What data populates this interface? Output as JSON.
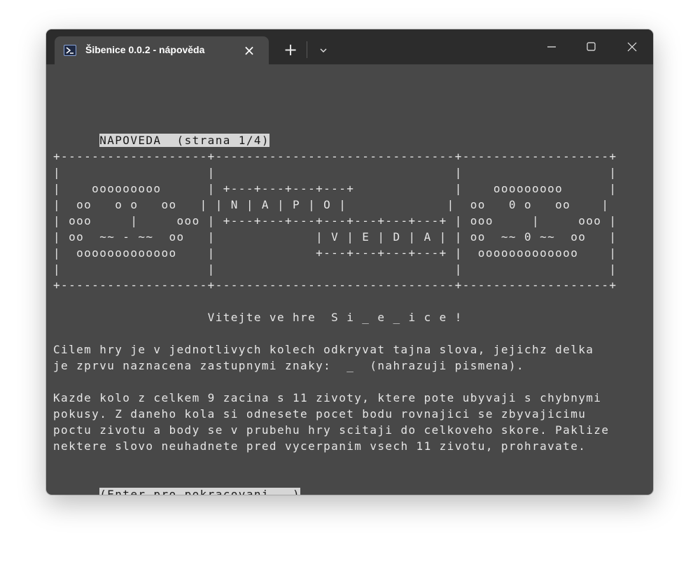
{
  "window": {
    "tab_title": "Šibenice 0.0.2 - nápověda",
    "tab_icon": "powershell-icon",
    "close_tab_glyph": "×",
    "new_tab_glyph": "+",
    "controls": {
      "minimize": "minimize-icon",
      "maximize": "maximize-icon",
      "close": "close-icon"
    }
  },
  "colors": {
    "terminal_bg": "#484848",
    "titlebar_bg": "#2c2c2c",
    "text": "#e6e6e6",
    "highlight_bg": "#d6d6d6",
    "highlight_text": "#1a1a1a"
  },
  "terminal": {
    "header": "NAPOVEDA  (strana 1/4)",
    "art": [
      "+-------------------+-------------------------------+-------------------+",
      "|                   |                               |                   |",
      "|    ooooooooo      | +---+---+---+---+             |    ooooooooo      |",
      "|  oo   o o   oo   | | N | A | P | O |             |  oo   0 o   oo    |",
      "| ooo     |     ooo | +---+---+---+---+---+---+---+ | ooo     |     ooo |",
      "| oo  ~~ - ~~  oo   |             | V | E | D | A | | oo  ~~ 0 ~~  oo   |",
      "|  ooooooooooooo    |             +---+---+---+---+ |  ooooooooooooo    |",
      "|                   |                               |                   |",
      "+-------------------+-------------------------------+-------------------+"
    ],
    "welcome": "                    Vitejte ve hre  S i _ e _ i c e !",
    "para1": [
      "Cilem hry je v jednotlivych kolech odkryvat tajna slova, jejichz delka",
      "je zprvu naznacena zastupnymi znaky:  _  (nahrazuji pismena)."
    ],
    "para2": [
      "Kazde kolo z celkem 9 zacina s 11 zivoty, ktere pote ubyvaji s chybnymi",
      "pokusy. Z daneho kola si odnesete pocet bodu rovnajici se zbyvajicimu",
      "poctu zivotu a body se v prubehu hry scitaji do celkoveho skore. Paklize",
      "nektere slovo neuhadnete pred vycerpanim vsech 11 zivotu, prohravate."
    ],
    "prompt": "(Enter pro pokracovani...)"
  }
}
